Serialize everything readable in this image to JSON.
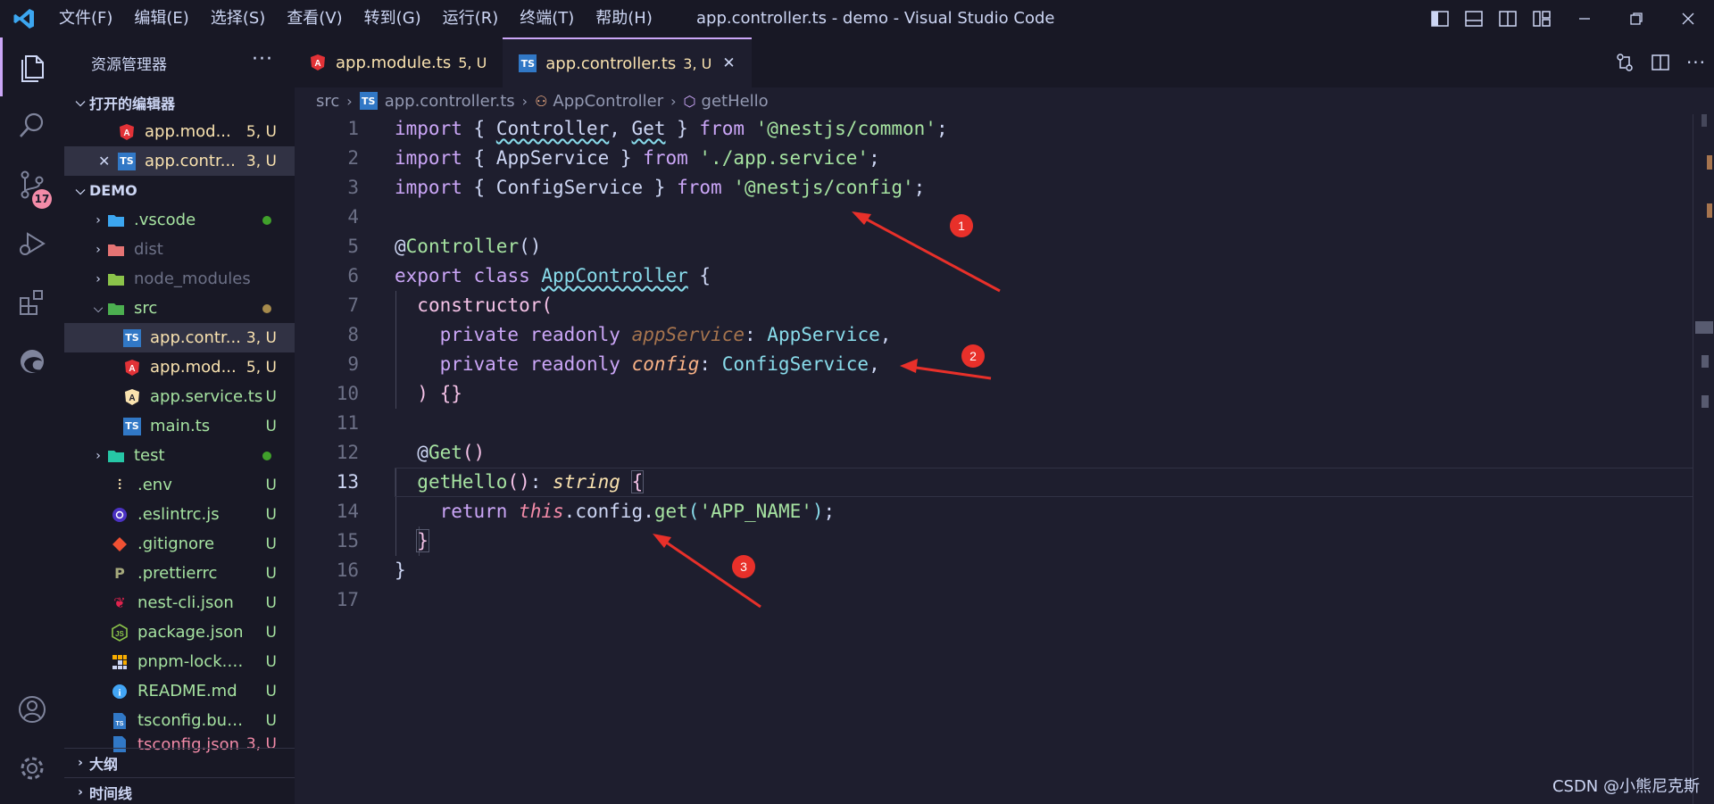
{
  "titlebar": {
    "menus": [
      "文件(F)",
      "编辑(E)",
      "选择(S)",
      "查看(V)",
      "转到(G)",
      "运行(R)",
      "终端(T)",
      "帮助(H)"
    ],
    "window_title": "app.controller.ts - demo - Visual Studio Code"
  },
  "activity_bar": {
    "scm_badge": "17",
    "icons": [
      "explorer-icon",
      "search-icon",
      "source-control-icon",
      "run-debug-icon",
      "extensions-icon",
      "edge-icon",
      "account-icon",
      "settings-gear-icon"
    ]
  },
  "sidebar": {
    "title": "资源管理器",
    "more": "···",
    "open_editors_label": "打开的编辑器",
    "open_editors": [
      {
        "name": "app.mod...",
        "status": "5, U"
      },
      {
        "name": "app.contr...",
        "status": "3, U",
        "close": "✕"
      }
    ],
    "project_label": "DEMO",
    "tree": [
      {
        "name": ".vscode",
        "status": ""
      },
      {
        "name": "dist",
        "status": ""
      },
      {
        "name": "node_modules",
        "status": ""
      },
      {
        "name": "src",
        "status": ""
      },
      {
        "name": "app.contr...",
        "status": "3, U"
      },
      {
        "name": "app.mod...",
        "status": "5, U"
      },
      {
        "name": "app.service.ts",
        "status": "U"
      },
      {
        "name": "main.ts",
        "status": "U"
      },
      {
        "name": "test",
        "status": ""
      },
      {
        "name": ".env",
        "status": "U"
      },
      {
        "name": ".eslintrc.js",
        "status": "U"
      },
      {
        "name": ".gitignore",
        "status": "U"
      },
      {
        "name": ".prettierrc",
        "status": "U"
      },
      {
        "name": "nest-cli.json",
        "status": "U"
      },
      {
        "name": "package.json",
        "status": "U"
      },
      {
        "name": "pnpm-lock.y...",
        "status": "U"
      },
      {
        "name": "README.md",
        "status": "U"
      },
      {
        "name": "tsconfig.buil...",
        "status": "U"
      },
      {
        "name": "tsconfig.json",
        "status": "3, U"
      }
    ],
    "outline_label": "大纲",
    "timeline_label": "时间线"
  },
  "tabs": [
    {
      "label": "app.module.ts",
      "status": "5, U"
    },
    {
      "label": "app.controller.ts",
      "status": "3, U",
      "close": "✕"
    }
  ],
  "breadcrumb": [
    "src",
    "app.controller.ts",
    "AppController",
    "getHello"
  ],
  "editor": {
    "line_numbers": [
      "1",
      "2",
      "3",
      "4",
      "5",
      "6",
      "7",
      "8",
      "9",
      "10",
      "11",
      "12",
      "13",
      "14",
      "15",
      "16",
      "17"
    ],
    "current_line": 13
  },
  "annotations": [
    "1",
    "2",
    "3"
  ],
  "watermark": "CSDN @小熊尼克斯",
  "colors": {
    "accent": "#cba6f7",
    "background": "#1e1e2e",
    "sidebar": "#181825",
    "annotation": "#e8302a"
  }
}
